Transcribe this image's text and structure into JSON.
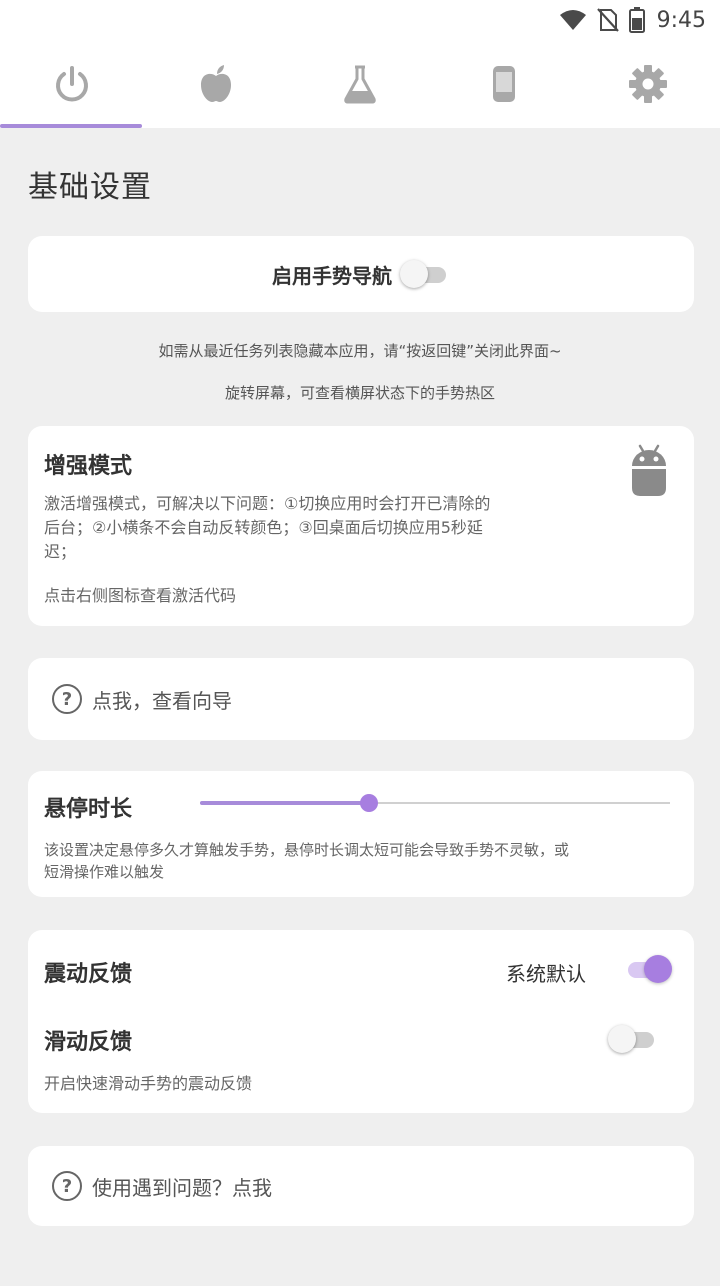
{
  "status": {
    "time": "9:45"
  },
  "tabs": [
    {
      "icon": "power-icon",
      "active": true
    },
    {
      "icon": "apple-icon",
      "active": false
    },
    {
      "icon": "flask-icon",
      "active": false
    },
    {
      "icon": "phone-icon",
      "active": false
    },
    {
      "icon": "gear-icon",
      "active": false
    }
  ],
  "section": {
    "title": "基础设置"
  },
  "gesture_nav": {
    "label": "启用手势导航",
    "enabled": false
  },
  "hints": {
    "line1": "如需从最近任务列表隐藏本应用，请“按返回键”关闭此界面~",
    "line2": "旋转屏幕，可查看横屏状态下的手势热区"
  },
  "enhanced_mode": {
    "title": "增强模式",
    "desc_line1": "激活增强模式，可解决以下问题：①切换应用时会打开已清除的",
    "desc_line2": "后台；②小横条不会自动反转颜色；③回桌面后切换应用5秒延",
    "desc_line3": "迟；",
    "tip": "点击右侧图标查看激活代码",
    "icon": "android-icon"
  },
  "guide": {
    "label": "点我，查看向导"
  },
  "hover_duration": {
    "title": "悬停时长",
    "value_fraction": 0.36,
    "desc_line1": "该设置决定悬停多久才算触发手势，悬停时长调太短可能会导致手势不灵敏，或",
    "desc_line2": "短滑操作难以触发"
  },
  "vibration": {
    "title": "震动反馈",
    "value": "系统默认",
    "enabled": true
  },
  "swipe_feedback": {
    "title": "滑动反馈",
    "desc": "开启快速滑动手势的震动反馈",
    "enabled": false
  },
  "help": {
    "label": "使用遇到问题？点我"
  },
  "colors": {
    "accent": "#a78bda",
    "accent_strong": "#a77ee0",
    "background": "#efefef"
  }
}
